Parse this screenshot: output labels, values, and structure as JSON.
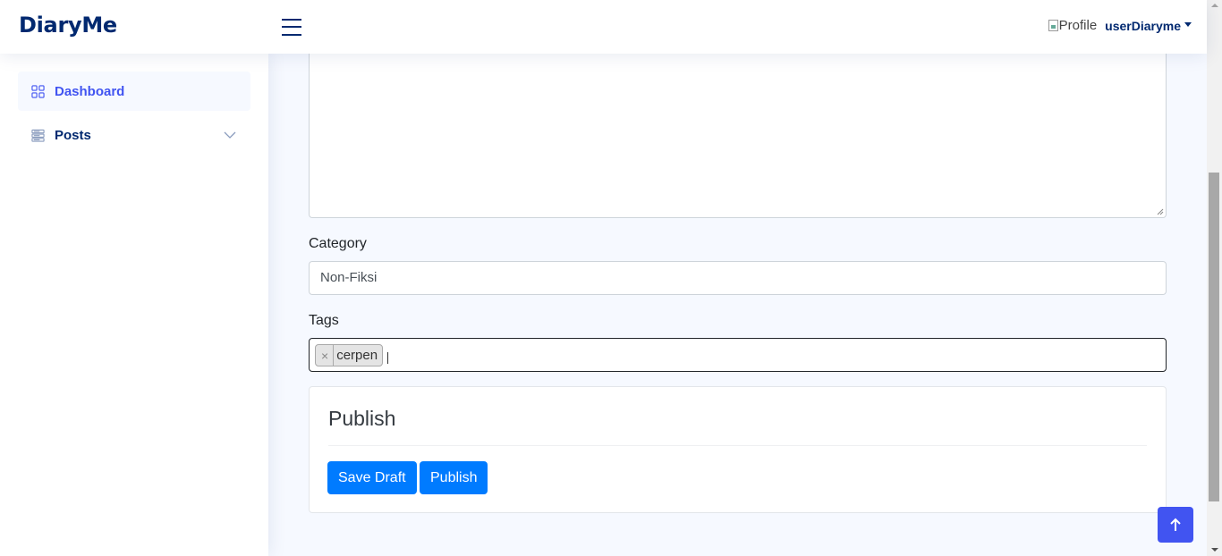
{
  "header": {
    "logo": "DiaryMe",
    "profile_img_alt": "Profile",
    "username": "userDiaryme"
  },
  "sidebar": {
    "items": [
      {
        "label": "Dashboard",
        "icon": "grid-icon",
        "active": true
      },
      {
        "label": "Posts",
        "icon": "menu-list-icon",
        "active": false
      }
    ]
  },
  "form": {
    "category_label": "Category",
    "category_value": "Non-Fiksi",
    "tags_label": "Tags",
    "tags": [
      "cerpen"
    ],
    "tag_remove_symbol": "×"
  },
  "publish_card": {
    "title": "Publish",
    "save_draft_label": "Save Draft",
    "publish_label": "Publish"
  },
  "colors": {
    "brand": "#012970",
    "accent": "#4154f1",
    "button": "#007bff"
  }
}
